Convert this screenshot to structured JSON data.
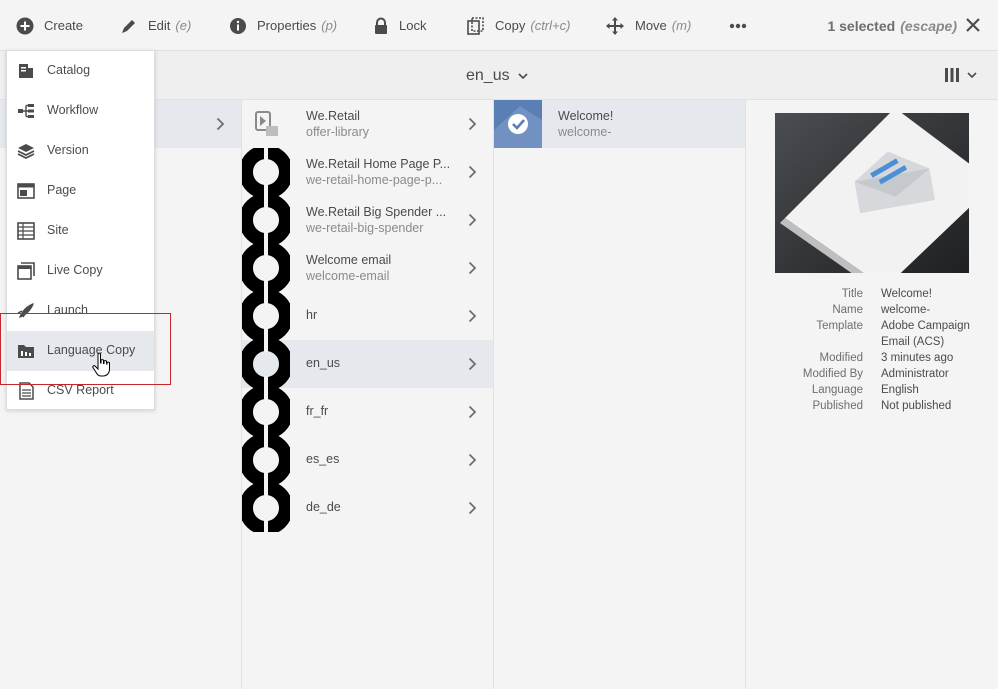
{
  "toolbar": {
    "create": "Create",
    "edit": "Edit",
    "edit_kbd": "(e)",
    "properties": "Properties",
    "properties_kbd": "(p)",
    "lock": "Lock",
    "copy": "Copy",
    "copy_kbd": "(ctrl+c)",
    "move": "Move",
    "move_kbd": "(m)",
    "more_icon": "more-icon",
    "selected": "1 selected",
    "selected_kbd": "(escape)"
  },
  "path": {
    "title": "en_us"
  },
  "create_menu": {
    "items": [
      {
        "label": "Catalog",
        "icon": "catalog-icon"
      },
      {
        "label": "Workflow",
        "icon": "workflow-icon"
      },
      {
        "label": "Version",
        "icon": "version-icon"
      },
      {
        "label": "Page",
        "icon": "page-icon"
      },
      {
        "label": "Site",
        "icon": "site-icon"
      },
      {
        "label": "Live Copy",
        "icon": "live-copy-icon"
      },
      {
        "label": "Launch",
        "icon": "launch-icon"
      },
      {
        "label": "Language Copy",
        "icon": "language-copy-icon"
      },
      {
        "label": "CSV Report",
        "icon": "csv-report-icon"
      }
    ],
    "hovered": "Language Copy"
  },
  "column2": {
    "items": [
      {
        "title": "We.Retail",
        "name": "offer-library"
      },
      {
        "title": "We.Retail Home Page P...",
        "name": "we-retail-home-page-p..."
      },
      {
        "title": "We.Retail Big Spender ...",
        "name": "we-retail-big-spender"
      },
      {
        "title": "Welcome email",
        "name": "welcome-email"
      },
      {
        "title": "hr",
        "name": ""
      },
      {
        "title": "en_us",
        "name": ""
      },
      {
        "title": "fr_fr",
        "name": ""
      },
      {
        "title": "es_es",
        "name": ""
      },
      {
        "title": "de_de",
        "name": ""
      }
    ],
    "active": "en_us"
  },
  "column3": {
    "items": [
      {
        "title": "Welcome!",
        "name": "welcome-"
      }
    ]
  },
  "details": {
    "rows": [
      {
        "key": "Title",
        "value": "Welcome!"
      },
      {
        "key": "Name",
        "value": "welcome-"
      },
      {
        "key": "Template",
        "value": "Adobe Campaign"
      },
      {
        "key": "",
        "value": "Email (ACS)"
      },
      {
        "key": "Modified",
        "value": "3 minutes ago"
      },
      {
        "key": "Modified By",
        "value": "Administrator"
      },
      {
        "key": "Language",
        "value": "English"
      },
      {
        "key": "Published",
        "value": "Not published"
      }
    ]
  },
  "colors": {
    "accent_selection": "#e5e9ee",
    "highlight_border": "#c8262c",
    "thumb_blue": "#5a7fb5"
  }
}
